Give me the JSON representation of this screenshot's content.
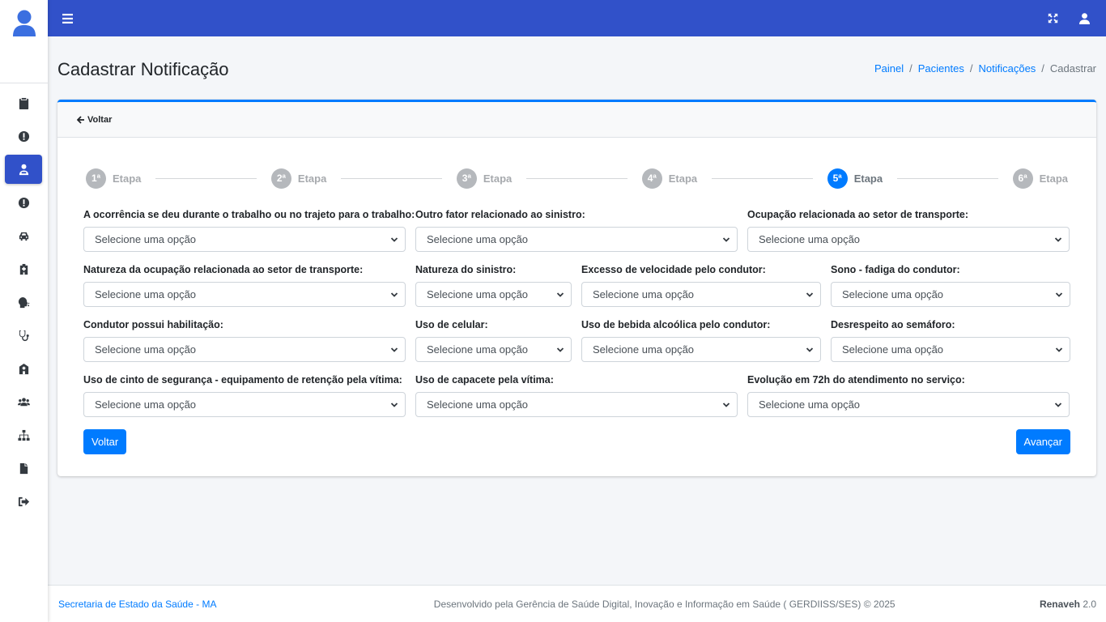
{
  "topbar": {
    "menu_icon": "bars-icon",
    "fullscreen_icon": "expand-arrows-icon",
    "user_icon": "user-icon"
  },
  "sidebar": {
    "items": [
      {
        "icon": "clipboard-icon",
        "active": false
      },
      {
        "icon": "alert-circle-icon",
        "active": false
      },
      {
        "icon": "user-injured-icon",
        "active": true
      },
      {
        "icon": "alert-circle-icon",
        "active": false
      },
      {
        "icon": "car-icon",
        "active": false
      },
      {
        "icon": "hospital-icon",
        "active": false
      },
      {
        "icon": "head-virus-icon",
        "active": false
      },
      {
        "icon": "stethoscope-icon",
        "active": false
      },
      {
        "icon": "clinic-icon",
        "active": false
      },
      {
        "icon": "users-icon",
        "active": false
      },
      {
        "icon": "sitemap-icon",
        "active": false
      },
      {
        "icon": "file-icon",
        "active": false
      },
      {
        "icon": "sign-out-icon",
        "active": false
      }
    ]
  },
  "header": {
    "title": "Cadastrar Notificação",
    "breadcrumb": [
      "Painel",
      "Pacientes",
      "Notificações",
      "Cadastrar"
    ],
    "breadcrumb_sep": "/"
  },
  "card": {
    "back_label": "Voltar",
    "steps": [
      {
        "num": "1ª",
        "label": "Etapa",
        "active": false
      },
      {
        "num": "2ª",
        "label": "Etapa",
        "active": false
      },
      {
        "num": "3ª",
        "label": "Etapa",
        "active": false
      },
      {
        "num": "4ª",
        "label": "Etapa",
        "active": false
      },
      {
        "num": "5ª",
        "label": "Etapa",
        "active": true
      },
      {
        "num": "6ª",
        "label": "Etapa",
        "active": false
      }
    ],
    "fields": {
      "ocorrencia_trabalho": {
        "label": "A ocorrência se deu durante o trabalho ou no trajeto para o trabalho:",
        "value": "Selecione uma opção"
      },
      "outro_fator": {
        "label": "Outro fator relacionado ao sinistro:",
        "value": "Selecione uma opção"
      },
      "ocupacao_transporte": {
        "label": "Ocupação relacionada ao setor de transporte:",
        "value": "Selecione uma opção"
      },
      "natureza_ocupacao": {
        "label": "Natureza da ocupação relacionada ao setor de transporte:",
        "value": "Selecione uma opção"
      },
      "natureza_sinistro": {
        "label": "Natureza do sinistro:",
        "value": "Selecione uma opção"
      },
      "excesso_velocidade": {
        "label": "Excesso de velocidade pelo condutor:",
        "value": "Selecione uma opção"
      },
      "sono_fadiga": {
        "label": "Sono - fadiga do condutor:",
        "value": "Selecione uma opção"
      },
      "habilitacao": {
        "label": "Condutor possui habilitação:",
        "value": "Selecione uma opção"
      },
      "celular": {
        "label": "Uso de celular:",
        "value": "Selecione uma opção"
      },
      "bebida": {
        "label": "Uso de bebida alcoólica pelo condutor:",
        "value": "Selecione uma opção"
      },
      "semaforo": {
        "label": "Desrespeito ao semáforo:",
        "value": "Selecione uma opção"
      },
      "cinto": {
        "label": "Uso de cinto de segurança - equipamento de retenção pela vítima:",
        "value": "Selecione uma opção"
      },
      "capacete": {
        "label": "Uso de capacete pela vítima:",
        "value": "Selecione uma opção"
      },
      "evolucao": {
        "label": "Evolução em 72h do atendimento no serviço:",
        "value": "Selecione uma opção"
      }
    },
    "btn_back": "Voltar",
    "btn_next": "Avançar"
  },
  "footer": {
    "left": "Secretaria de Estado da Saúde - MA",
    "center": "Desenvolvido pela Gerência de Saúde Digital, Inovação e Informação em Saúde ( GERDIISS/SES) © 2025",
    "brand": "Renaveh",
    "version": "2.0"
  },
  "colors": {
    "primary": "#007bff",
    "topbar": "#3151c9",
    "sidebar_active": "#3151c9"
  }
}
